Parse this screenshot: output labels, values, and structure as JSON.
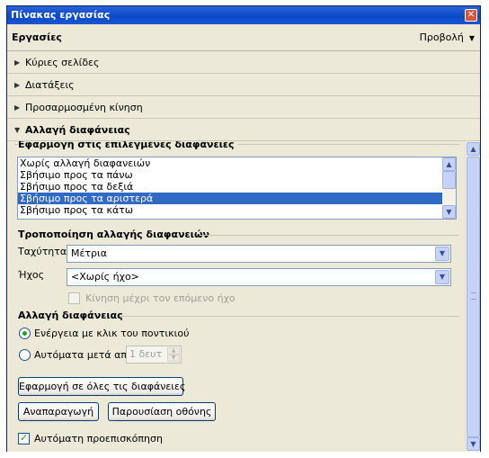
{
  "window": {
    "title": "Πίνακας εργασίας",
    "close_glyph": "✕"
  },
  "header": {
    "title": "Εργασίες",
    "view_label": "Προβολή",
    "view_caret": "▼"
  },
  "sections": [
    {
      "label": "Κύριες σελίδες",
      "expanded": false,
      "icon": "▶"
    },
    {
      "label": "Διατάξεις",
      "expanded": false,
      "icon": "▶"
    },
    {
      "label": "Προσαρμοσμένη κίνηση",
      "expanded": false,
      "icon": "▶"
    },
    {
      "label": "Αλλαγή διαφάνειας",
      "expanded": true,
      "icon": "▼"
    }
  ],
  "apply_group": {
    "title": "Εφαρμογή στις επιλεγμένες διαφάνειες",
    "items": [
      "Χωρίς αλλαγή διαφανειών",
      "Σβήσιμο προς τα πάνω",
      "Σβήσιμο προς τα δεξιά",
      "Σβήσιμο προς τα αριστερά",
      "Σβήσιμο προς τα κάτω"
    ],
    "selected_index": 3
  },
  "modify_group": {
    "title": "Τροποποίηση αλλαγής διαφανειών",
    "speed_label": "Ταχύτητα",
    "speed_value": "Μέτρια",
    "sound_label": "Ήχος",
    "sound_value": "<Χωρίς ήχο>",
    "loop_label": "Κίνηση μέχρι τον επόμενο ήχο"
  },
  "advance_group": {
    "title": "Αλλαγή διαφάνειας",
    "on_click_label": "Ενέργεια με κλικ του ποντικιού",
    "auto_label": "Αυτόματα μετά από",
    "auto_value": "1 δευτ",
    "selected": "on_click"
  },
  "buttons": {
    "apply_all": "Εφαρμογή σε όλες τις διαφάνειες",
    "play": "Αναπαραγωγή",
    "slideshow": "Παρουσίαση οθόνης"
  },
  "autopreview": {
    "label": "Αυτόματη προεπισκόπηση",
    "checked": true
  },
  "glyphs": {
    "up": "▲",
    "down": "▼",
    "check": "✓"
  },
  "colors": {
    "titlebar": "#0a48c8",
    "selection": "#316ac5",
    "panel": "#ece9d8"
  }
}
